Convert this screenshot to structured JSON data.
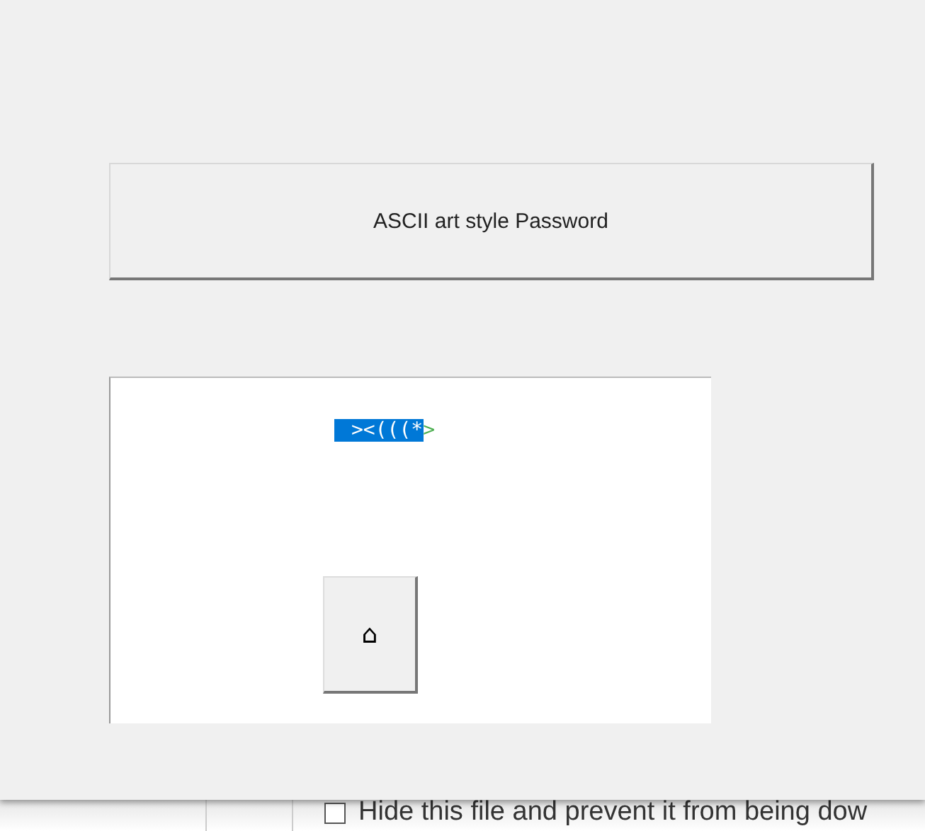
{
  "dialog": {
    "button": "ASCII art style Password",
    "password_display": {
      "selected_text": "><(((*",
      "trailing_text": ">",
      "selected": true
    },
    "home_button": "⌂"
  },
  "background_page": {
    "checkbox": {
      "label": "Hide this file and prevent it from being dow",
      "checked": false
    }
  }
}
